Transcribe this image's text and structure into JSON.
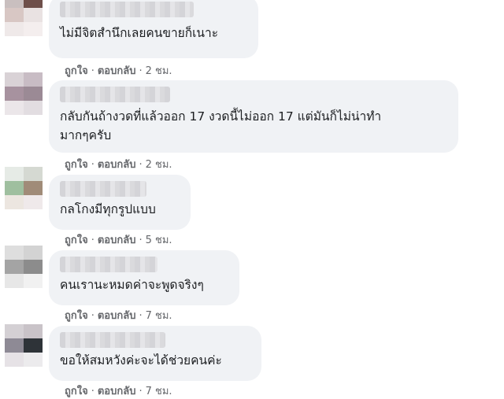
{
  "comments": [
    {
      "text": "ไม่มีจิตสำนึกเลยคนขายก็เนาะ",
      "like_label": "ถูกใจ",
      "reply_label": "ตอบกลับ",
      "separator": "·",
      "time": "2 ชม.",
      "avatar_colors": [
        "#c9bfbf",
        "#6e4f4a",
        "#d8c7c4",
        "#e9e2e2",
        "#efe9e9",
        "#f4eeee"
      ]
    },
    {
      "text": "กลับกันถ้างวดที่แล้วออก 17 งวดนี้ไม่ออก 17 แต่มันก็ไม่น่าทำ\nมากๆครับ",
      "like_label": "ถูกใจ",
      "reply_label": "ตอบกลับ",
      "separator": "·",
      "time": "2 ชม.",
      "avatar_colors": [
        "#d9d2d6",
        "#c8bcc4",
        "#a7929f",
        "#9b8a95",
        "#ebe6e9",
        "#e2dde1"
      ]
    },
    {
      "text": "กลโกงมีทุกรูปแบบ",
      "like_label": "ถูกใจ",
      "reply_label": "ตอบกลับ",
      "separator": "·",
      "time": "5 ชม.",
      "avatar_colors": [
        "#e6ebe6",
        "#d5d9d2",
        "#9fbf9f",
        "#a08b78",
        "#ece6e0",
        "#efe9ea"
      ]
    },
    {
      "text": "คนเรานะหมดค่าจะพูดจริงๆ",
      "like_label": "ถูกใจ",
      "reply_label": "ตอบกลับ",
      "separator": "·",
      "time": "7 ชม.",
      "avatar_colors": [
        "#dedede",
        "#d3d3d3",
        "#a4a4a4",
        "#8c8c8c",
        "#e7e7e7",
        "#f1f1f1"
      ]
    },
    {
      "text": "ขอให้สมหวังค่ะจะได้ช่วยคนค่ะ",
      "like_label": "ถูกใจ",
      "reply_label": "ตอบกลับ",
      "separator": "·",
      "time": "7 ชม.",
      "avatar_colors": [
        "#d4d0d4",
        "#c9c3c8",
        "#8e8a95",
        "#2e3338",
        "#e6e2e6",
        "#ecebed"
      ]
    }
  ]
}
